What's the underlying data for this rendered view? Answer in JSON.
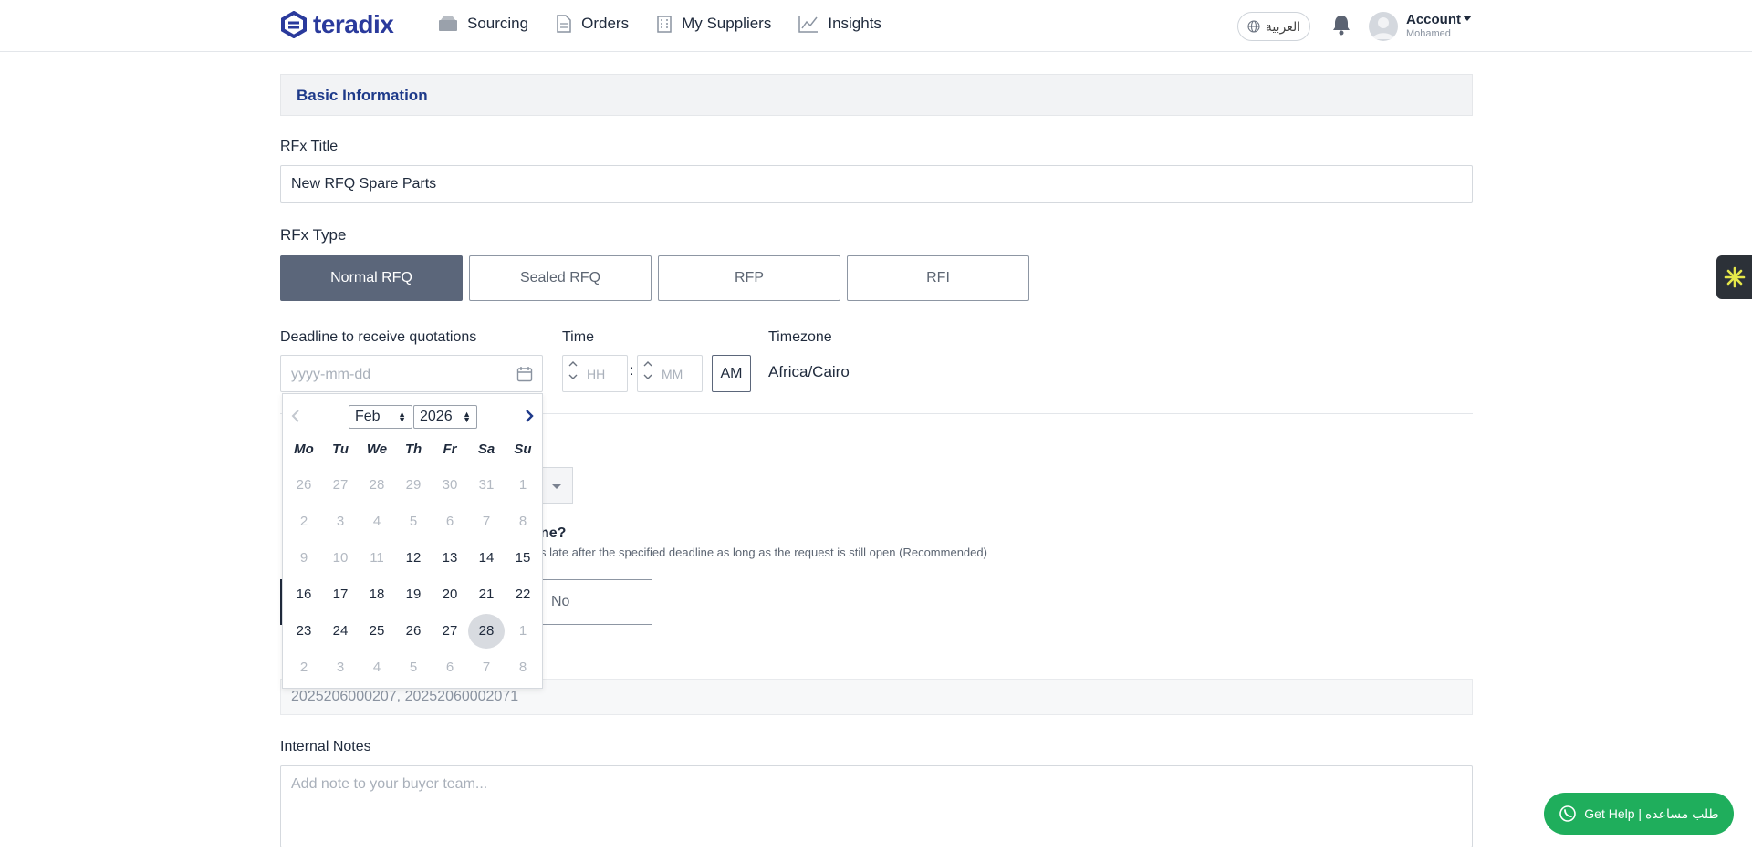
{
  "brand": {
    "name": "teradix",
    "color": "#2a3a9c"
  },
  "nav": [
    {
      "label": "Sourcing",
      "icon": "box-icon"
    },
    {
      "label": "Orders",
      "icon": "document-icon"
    },
    {
      "label": "My Suppliers",
      "icon": "building-icon"
    },
    {
      "label": "Insights",
      "icon": "chart-line-icon"
    }
  ],
  "header": {
    "language": "العربية",
    "account_label": "Account",
    "account_user": "Mohamed"
  },
  "form": {
    "section_title": "Basic Information",
    "rfx_title_label": "RFx Title",
    "rfx_title_value": "New RFQ Spare Parts",
    "rfx_type_label": "RFx Type",
    "rfx_types": [
      "Normal RFQ",
      "Sealed RFQ",
      "RFP",
      "RFI"
    ],
    "rfx_type_selected": "Normal RFQ",
    "deadline_label": "Deadline to receive quotations",
    "deadline_placeholder": "yyyy-mm-dd",
    "time_label": "Time",
    "hour_placeholder": "HH",
    "minute_placeholder": "MM",
    "ampm": "AM",
    "timezone_label": "Timezone",
    "timezone_value": "Africa/Cairo",
    "late_question_partial": "ne?",
    "late_desc_partial": "s late after the specified deadline as long as the request is still open (Recommended)",
    "no_label": "No",
    "pr_value": "2025206000207, 20252060002071",
    "internal_notes_label": "Internal Notes",
    "internal_notes_placeholder": "Add note to your buyer team..."
  },
  "calendar": {
    "month": "Feb",
    "year": "2026",
    "weekdays": [
      "Mo",
      "Tu",
      "We",
      "Th",
      "Fr",
      "Sa",
      "Su"
    ],
    "weeks": [
      [
        "26",
        "27",
        "28",
        "29",
        "30",
        "31",
        "1"
      ],
      [
        "2",
        "3",
        "4",
        "5",
        "6",
        "7",
        "8"
      ],
      [
        "9",
        "10",
        "11",
        "12",
        "13",
        "14",
        "15"
      ],
      [
        "16",
        "17",
        "18",
        "19",
        "20",
        "21",
        "22"
      ],
      [
        "23",
        "24",
        "25",
        "26",
        "27",
        "28",
        "1"
      ],
      [
        "2",
        "3",
        "4",
        "5",
        "6",
        "7",
        "8"
      ]
    ],
    "muted": [
      [
        true,
        true,
        true,
        true,
        true,
        true,
        true
      ],
      [
        true,
        true,
        true,
        true,
        true,
        true,
        true
      ],
      [
        true,
        true,
        true,
        false,
        false,
        false,
        false
      ],
      [
        false,
        false,
        false,
        false,
        false,
        false,
        false
      ],
      [
        false,
        false,
        false,
        false,
        false,
        false,
        true
      ],
      [
        true,
        true,
        true,
        true,
        true,
        true,
        true
      ]
    ],
    "today": "28"
  },
  "help_button": "Get Help | طلب مساعده",
  "colors": {
    "primary": "#1e3a8a",
    "selected": "#5b667a",
    "help": "#1fae5c"
  }
}
